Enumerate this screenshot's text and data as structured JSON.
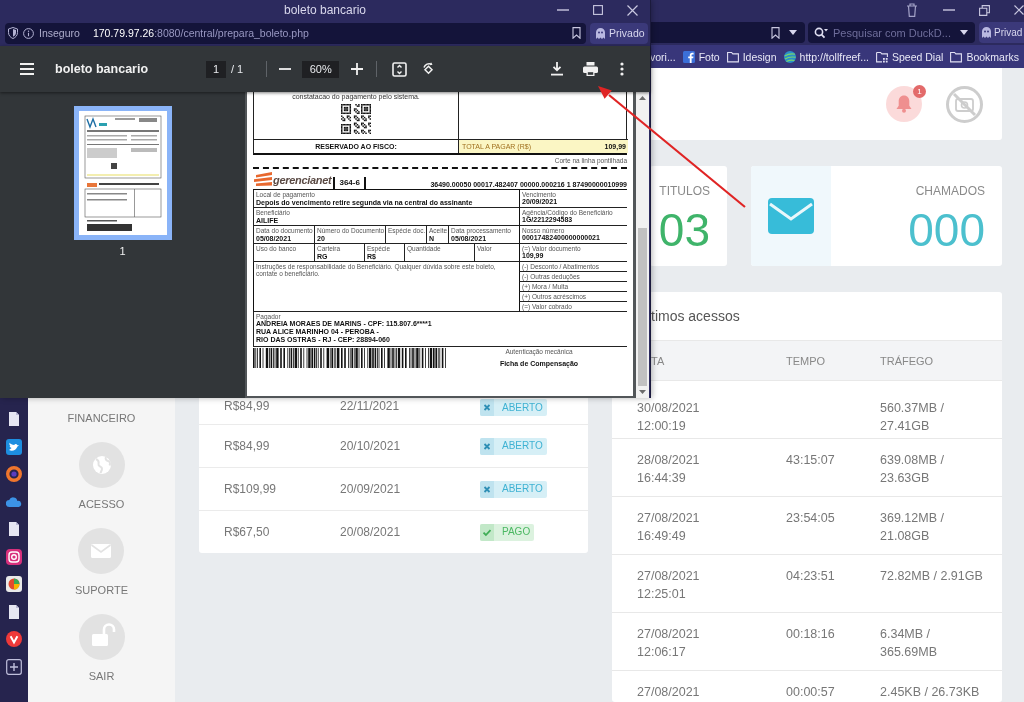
{
  "desktop_browser": {
    "search": {
      "placeholder": "Pesquisar com DuckD..."
    },
    "private_label": "Privad",
    "bookmarks": [
      {
        "label": "vori...",
        "kind": "plain"
      },
      {
        "label": "Foto",
        "kind": "social"
      },
      {
        "label": "Idesign",
        "kind": "folder"
      },
      {
        "label": "http://tollfreef...",
        "kind": "globe"
      },
      {
        "label": "Speed Dial",
        "kind": "speed_dial"
      },
      {
        "label": "Bookmarks",
        "kind": "folder"
      }
    ]
  },
  "site": {
    "sidebar": [
      {
        "label": "FINANCEIRO",
        "kind": "text"
      },
      {
        "label": "ACESSO",
        "kind": "globe"
      },
      {
        "label": "SUPORTE",
        "kind": "mail"
      },
      {
        "label": "SAIR",
        "kind": "lock"
      }
    ],
    "notifications": {
      "count": "1"
    },
    "stats": [
      {
        "label": "TITULOS",
        "value": "03",
        "color": "#3fb46a",
        "kind": "plain"
      },
      {
        "label": "CHAMADOS",
        "value": "000",
        "color": "#4cc0ce",
        "kind": "mail"
      }
    ],
    "invoices": [
      {
        "amount": "R$84,99",
        "due": "22/11/2021",
        "status": "ABERTO",
        "paid": false
      },
      {
        "amount": "R$84,99",
        "due": "20/10/2021",
        "status": "ABERTO",
        "paid": false
      },
      {
        "amount": "R$109,99",
        "due": "20/09/2021",
        "status": "ABERTO",
        "paid": false
      },
      {
        "amount": "R$67,50",
        "due": "20/08/2021",
        "status": "PAGO",
        "paid": true
      }
    ],
    "access_log": {
      "title": "timos acessos",
      "columns": [
        "TA",
        "TEMPO",
        "TRÁFEGO"
      ],
      "rows": [
        {
          "date": "30/08/2021 12:00:19",
          "traffic": "560.37MB / 27.41GB"
        },
        {
          "date": "28/08/2021 16:44:39",
          "duration": "43:15:07",
          "traffic": "639.08MB / 23.63GB"
        },
        {
          "date": "27/08/2021 16:49:49",
          "duration": "23:54:05",
          "traffic": "369.12MB / 21.08GB"
        },
        {
          "date": "27/08/2021 12:25:01",
          "duration": "04:23:51",
          "traffic": "72.82MB / 2.91GB"
        },
        {
          "date": "27/08/2021 12:06:17",
          "duration": "00:18:16",
          "traffic": "6.34MB / 365.69MB"
        },
        {
          "date": "27/08/2021",
          "duration": "00:00:57",
          "traffic": "2.45KB / 26.73KB"
        }
      ]
    }
  },
  "popup": {
    "title": "boleto bancario",
    "address": {
      "security": "Inseguro",
      "host": "170.79.97.26",
      "path": ":8080/central/prepara_boleto.php"
    },
    "private_label": "Privado",
    "pdf_toolbar": {
      "title": "boleto bancario",
      "page": "1",
      "page_total": "/ 1",
      "zoom": "60%"
    },
    "thumbnails": [
      {
        "label": "1",
        "selected": true
      }
    ],
    "document": {
      "notice": "constatacao do pagamento pelo sistema.",
      "fiscal_label": "RESERVADO AO FISCO:",
      "total_label": "TOTAL A PAGAR (R$)",
      "total": "109,99",
      "cut_hint": "Corte na linha pontilhada",
      "bank_name": "gerencianet",
      "bank_code": "364-6",
      "digitable_line": "36490.00050 00017.482407 00000.000216 1 87490000010999",
      "fields": [
        {
          "label": "Local de pagamento",
          "value": "Depois do vencimento retire segunda via na central do assinante"
        },
        {
          "label": "Vencimento",
          "value": "20/09/2021"
        },
        {
          "label": "Beneficiário",
          "value": "AILIFE"
        },
        {
          "label": "Agência/Código do Beneficiário",
          "value": "1G/2212294583"
        },
        {
          "label": "Data do documento",
          "value": "05/08/2021"
        },
        {
          "label": "Número do Documento",
          "value": "20"
        },
        {
          "label": "Espécie doc."
        },
        {
          "label": "Aceite",
          "value": "N"
        },
        {
          "label": "Data processamento",
          "value": "05/08/2021"
        },
        {
          "label": "Nosso número",
          "value": "00017482400000000021"
        },
        {
          "label": "Uso do banco"
        },
        {
          "label": "Carteira",
          "value": "RG"
        },
        {
          "label": "Espécie",
          "value": "R$"
        },
        {
          "label": "Quantidade"
        },
        {
          "label": "Valor"
        },
        {
          "label": "(=) Valor documento",
          "value": "109,99"
        },
        {
          "label": "(-) Desconto / Abatimentos"
        },
        {
          "label": "(-) Outras deduções"
        },
        {
          "label": "(+) Mora / Multa"
        },
        {
          "label": "(+) Outros acréscimos"
        },
        {
          "label": "(=) Valor cobrado"
        }
      ],
      "instructions": "Instruções de responsabilidade do Beneficiário. Qualquer dúvida sobre este boleto, contate o beneficiário.",
      "payer_label": "Pagador",
      "payer_lines": [
        "ANDREIA MORAES DE MARINS - CPF: 115.807.6****1",
        "RUA ALICE MARINHO 04 - PEROBA -",
        "RIO DAS OSTRAS - RJ - CEP: 28894-060"
      ],
      "auth_label": "Autenticação mecânica",
      "slip_title": "Ficha de Compensação"
    }
  }
}
